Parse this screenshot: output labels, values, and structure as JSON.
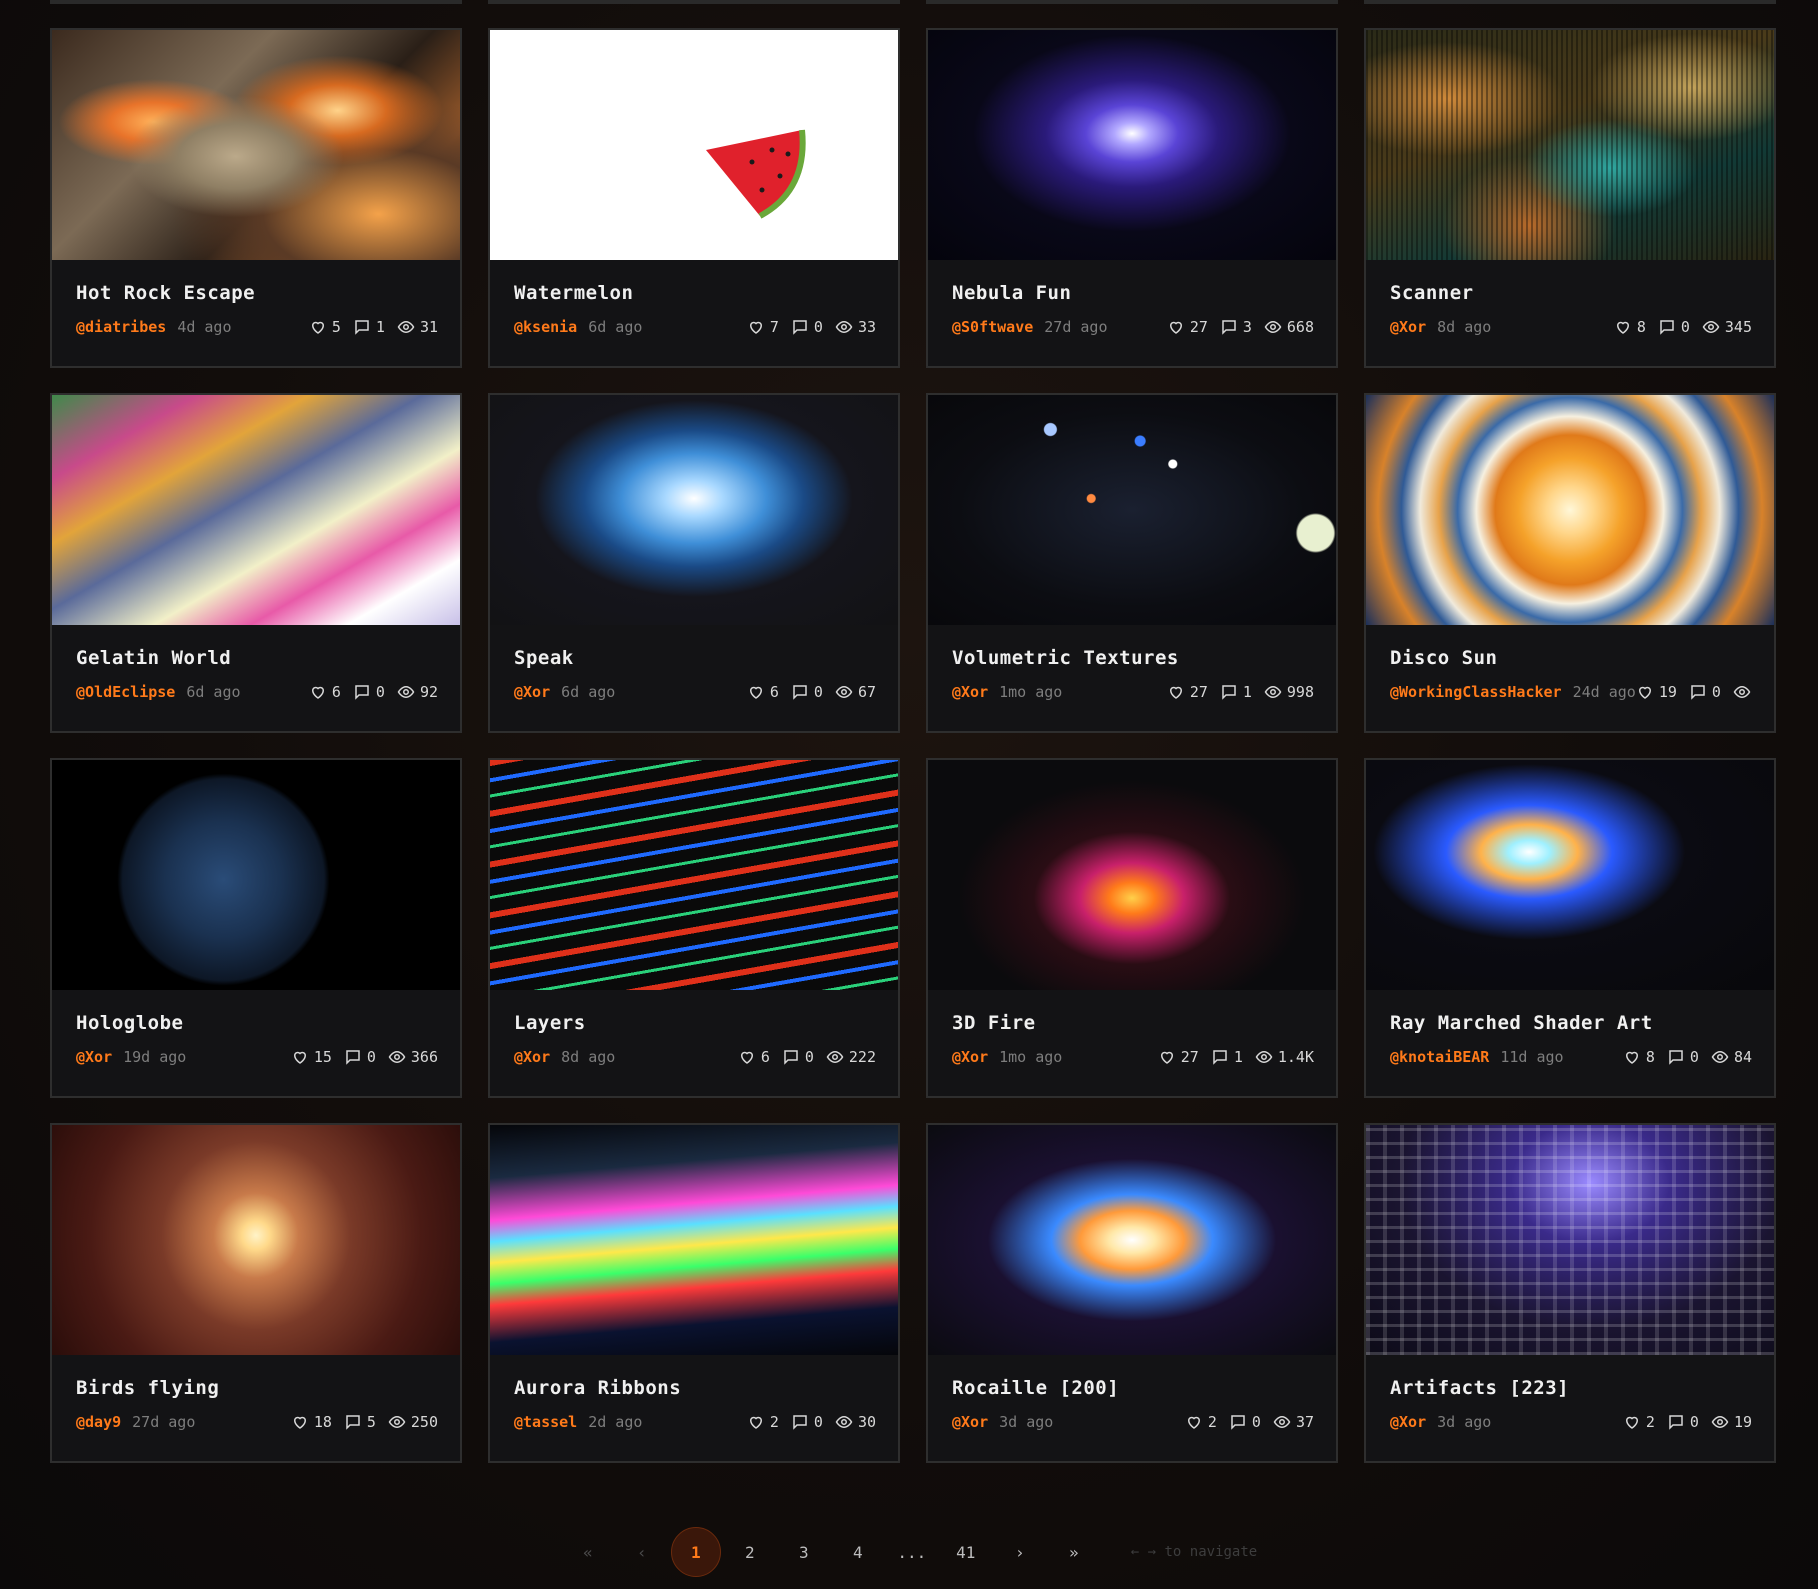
{
  "cards": [
    {
      "title": "Hot Rock Escape",
      "author": "@diatribes",
      "ago": "4d ago",
      "likes": "5",
      "comments": "1",
      "views": "31",
      "thumb": "hot-rock-escape-thumbnail"
    },
    {
      "title": "Watermelon",
      "author": "@ksenia",
      "ago": "6d ago",
      "likes": "7",
      "comments": "0",
      "views": "33",
      "thumb": "watermelon-thumbnail"
    },
    {
      "title": "Nebula Fun",
      "author": "@S0ftwave",
      "ago": "27d ago",
      "likes": "27",
      "comments": "3",
      "views": "668",
      "thumb": "nebula-fun-thumbnail"
    },
    {
      "title": "Scanner",
      "author": "@Xor",
      "ago": "8d ago",
      "likes": "8",
      "comments": "0",
      "views": "345",
      "thumb": "scanner-thumbnail"
    },
    {
      "title": "Gelatin World",
      "author": "@OldEclipse",
      "ago": "6d ago",
      "likes": "6",
      "comments": "0",
      "views": "92",
      "thumb": "gelatin-world-thumbnail"
    },
    {
      "title": "Speak",
      "author": "@Xor",
      "ago": "6d ago",
      "likes": "6",
      "comments": "0",
      "views": "67",
      "thumb": "speak-thumbnail"
    },
    {
      "title": "Volumetric Textures",
      "author": "@Xor",
      "ago": "1mo ago",
      "likes": "27",
      "comments": "1",
      "views": "998",
      "thumb": "volumetric-textures-thumbnail"
    },
    {
      "title": "Disco Sun",
      "author": "@WorkingClassHacker",
      "ago": "24d ago",
      "likes": "19",
      "comments": "0",
      "views": "",
      "thumb": "disco-sun-thumbnail"
    },
    {
      "title": "Hologlobe",
      "author": "@Xor",
      "ago": "19d ago",
      "likes": "15",
      "comments": "0",
      "views": "366",
      "thumb": "hologlobe-thumbnail"
    },
    {
      "title": "Layers",
      "author": "@Xor",
      "ago": "8d ago",
      "likes": "6",
      "comments": "0",
      "views": "222",
      "thumb": "layers-thumbnail"
    },
    {
      "title": "3D Fire",
      "author": "@Xor",
      "ago": "1mo ago",
      "likes": "27",
      "comments": "1",
      "views": "1.4K",
      "thumb": "3d-fire-thumbnail"
    },
    {
      "title": "Ray Marched Shader Art",
      "author": "@knotaiBEAR",
      "ago": "11d ago",
      "likes": "8",
      "comments": "0",
      "views": "84",
      "thumb": "ray-marched-shader-art-thumbnail"
    },
    {
      "title": "Birds flying",
      "author": "@day9",
      "ago": "27d ago",
      "likes": "18",
      "comments": "5",
      "views": "250",
      "thumb": "birds-flying-thumbnail"
    },
    {
      "title": "Aurora Ribbons",
      "author": "@tassel",
      "ago": "2d ago",
      "likes": "2",
      "comments": "0",
      "views": "30",
      "thumb": "aurora-ribbons-thumbnail"
    },
    {
      "title": "Rocaille [200]",
      "author": "@Xor",
      "ago": "3d ago",
      "likes": "2",
      "comments": "0",
      "views": "37",
      "thumb": "rocaille-thumbnail"
    },
    {
      "title": "Artifacts [223]",
      "author": "@Xor",
      "ago": "3d ago",
      "likes": "2",
      "comments": "0",
      "views": "19",
      "thumb": "artifacts-thumbnail"
    }
  ],
  "pagination": {
    "first": "«",
    "prev": "‹",
    "pages": [
      "1",
      "2",
      "3",
      "4"
    ],
    "ellipsis": "...",
    "last_page": "41",
    "next": "›",
    "last": "»",
    "current": "1",
    "hint": "← → to navigate"
  },
  "colors": {
    "accent": "#ff7a1a",
    "card_bg": "#131315",
    "card_border": "#2e2e2e"
  },
  "icons": {
    "likes": "heart-icon",
    "comments": "comment-icon",
    "views": "eye-icon"
  }
}
